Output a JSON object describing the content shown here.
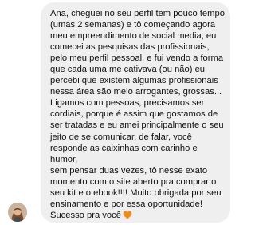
{
  "message": {
    "text": "Ana, cheguei no seu perfil tem pouco tempo\n(umas 2 semanas) e tô começando agora\nmeu empreendimento de social media, eu\ncomecei as pesquisas das profissionais,\npelo meu perfil pessoal, e fui vendo a forma\nque cada uma me cativava (ou não) eu\npercebi que existem algumas profissionais\nnessa área são meio arrogantes, grossas...\nLigamos com pessoas, precisamos ser\ncordiais, porque é assim que gostamos de\nser tratadas e eu amei principalmente o seu\njeito de se comunicar, de falar, você\nresponde as caixinhas com carinho e humor,\nsem pensar duas vezes, tô nesse exato\nmomento com o site aberto pra comprar o\nseu kit e o ebook!!!! Muito obrigada por seu\nensinamento e por essa oportunidade!\nSucesso pra você",
    "emoji_icon": "orange-heart-icon",
    "emoji_color": "#f08a1c"
  },
  "avatar": {
    "icon": "profile-photo"
  }
}
